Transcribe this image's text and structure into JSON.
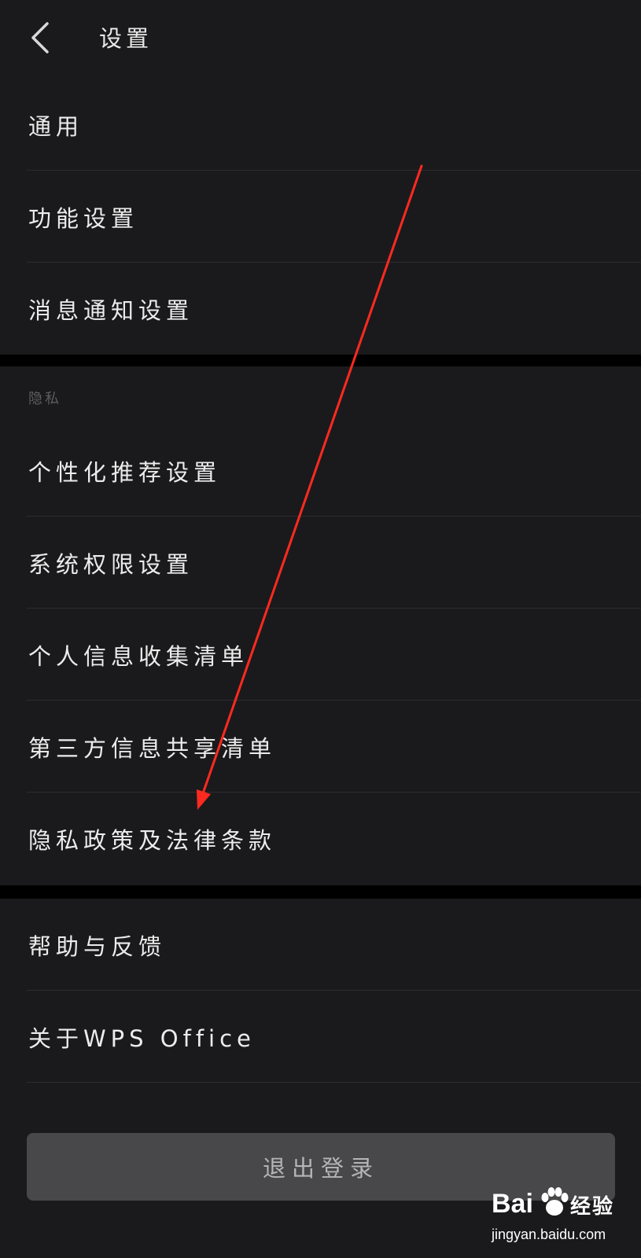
{
  "header": {
    "title": "设置"
  },
  "group1": {
    "items": [
      {
        "label": "通用"
      },
      {
        "label": "功能设置"
      },
      {
        "label": "消息通知设置"
      }
    ]
  },
  "privacy": {
    "section_title": "隐私",
    "items": [
      {
        "label": "个性化推荐设置"
      },
      {
        "label": "系统权限设置"
      },
      {
        "label": "个人信息收集清单"
      },
      {
        "label": "第三方信息共享清单"
      },
      {
        "label": "隐私政策及法律条款"
      }
    ]
  },
  "group3": {
    "items": [
      {
        "label": "帮助与反馈"
      },
      {
        "label": "关于WPS Office"
      }
    ]
  },
  "logout_label": "退出登录",
  "watermark": {
    "logo_text": "Bai",
    "jingyan_text": "经验",
    "url_text": "jingyan.baidu.com"
  },
  "colors": {
    "background": "#1a1a1c",
    "separator": "#000000",
    "annotation_arrow": "#ff2a1f",
    "logout_button": "#48484a"
  },
  "icons": {
    "back": "chevron-left-icon",
    "watermark_paw": "baidu-paw-icon"
  }
}
